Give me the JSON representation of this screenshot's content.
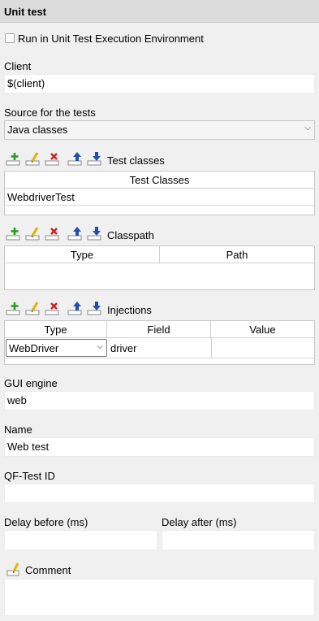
{
  "header": {
    "title": "Unit test"
  },
  "unit_test_env": {
    "label": "Run in Unit Test Execution Environment",
    "checked": false
  },
  "client": {
    "label": "Client",
    "value": "$(client)"
  },
  "source": {
    "label": "Source for the tests",
    "selected": "Java classes"
  },
  "test_classes": {
    "label": "Test classes",
    "columns": [
      "Test Classes"
    ],
    "rows": [
      [
        "WebdriverTest"
      ]
    ]
  },
  "classpath": {
    "label": "Classpath",
    "columns": [
      "Type",
      "Path"
    ],
    "rows": []
  },
  "injections": {
    "label": "Injections",
    "columns": [
      "Type",
      "Field",
      "Value"
    ],
    "rows": [
      {
        "type": "WebDriver",
        "field": "driver",
        "value": ""
      }
    ]
  },
  "gui_engine": {
    "label": "GUI engine",
    "value": "web"
  },
  "name": {
    "label": "Name",
    "value": "Web test"
  },
  "qftest_id": {
    "label": "QF-Test ID",
    "value": ""
  },
  "delay_before": {
    "label": "Delay before (ms)",
    "value": ""
  },
  "delay_after": {
    "label": "Delay after (ms)",
    "value": ""
  },
  "comment": {
    "label": "Comment",
    "value": ""
  },
  "toolbar_icons": [
    "add-icon",
    "edit-icon",
    "delete-icon",
    "move-up-icon",
    "move-down-icon"
  ],
  "colors": {
    "add": "#22a022",
    "edit": "#e0b400",
    "delete": "#cc1f1f",
    "arrow": "#1f4fb0"
  }
}
